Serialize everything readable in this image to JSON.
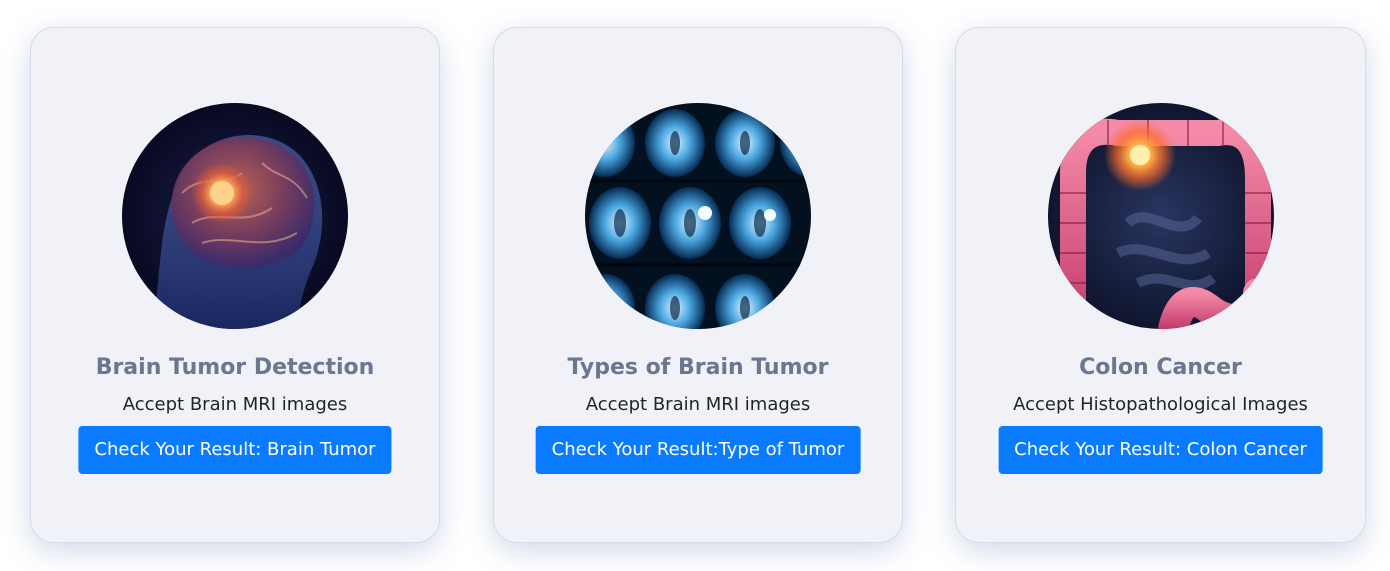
{
  "cards": [
    {
      "title": "Brain Tumor Detection",
      "subtitle": "Accept Brain MRI images",
      "button_label": "Check Your Result: Brain Tumor",
      "image": "brain-tumor-3d-illustration"
    },
    {
      "title": "Types of Brain Tumor",
      "subtitle": "Accept Brain MRI images",
      "button_label": "Check Your Result:Type of Tumor",
      "image": "brain-mri-scan-film"
    },
    {
      "title": "Colon Cancer",
      "subtitle": "Accept Histopathological Images",
      "button_label": "Check Your Result: Colon Cancer",
      "image": "colon-cancer-3d-illustration"
    }
  ],
  "colors": {
    "card_background": "#f0f2f7",
    "title": "#6b7691",
    "subtitle": "#1f2329",
    "button": "#0a7bff",
    "button_text": "#ffffff"
  }
}
